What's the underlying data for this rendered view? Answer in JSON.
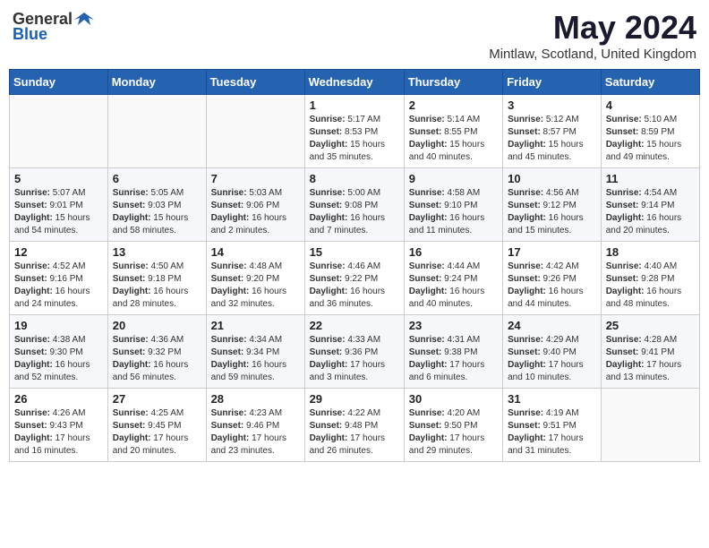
{
  "header": {
    "logo_general": "General",
    "logo_blue": "Blue",
    "title": "May 2024",
    "location": "Mintlaw, Scotland, United Kingdom"
  },
  "weekdays": [
    "Sunday",
    "Monday",
    "Tuesday",
    "Wednesday",
    "Thursday",
    "Friday",
    "Saturday"
  ],
  "weeks": [
    [
      {
        "day": "",
        "info": ""
      },
      {
        "day": "",
        "info": ""
      },
      {
        "day": "",
        "info": ""
      },
      {
        "day": "1",
        "info": "Sunrise: 5:17 AM\nSunset: 8:53 PM\nDaylight: 15 hours and 35 minutes."
      },
      {
        "day": "2",
        "info": "Sunrise: 5:14 AM\nSunset: 8:55 PM\nDaylight: 15 hours and 40 minutes."
      },
      {
        "day": "3",
        "info": "Sunrise: 5:12 AM\nSunset: 8:57 PM\nDaylight: 15 hours and 45 minutes."
      },
      {
        "day": "4",
        "info": "Sunrise: 5:10 AM\nSunset: 8:59 PM\nDaylight: 15 hours and 49 minutes."
      }
    ],
    [
      {
        "day": "5",
        "info": "Sunrise: 5:07 AM\nSunset: 9:01 PM\nDaylight: 15 hours and 54 minutes."
      },
      {
        "day": "6",
        "info": "Sunrise: 5:05 AM\nSunset: 9:03 PM\nDaylight: 15 hours and 58 minutes."
      },
      {
        "day": "7",
        "info": "Sunrise: 5:03 AM\nSunset: 9:06 PM\nDaylight: 16 hours and 2 minutes."
      },
      {
        "day": "8",
        "info": "Sunrise: 5:00 AM\nSunset: 9:08 PM\nDaylight: 16 hours and 7 minutes."
      },
      {
        "day": "9",
        "info": "Sunrise: 4:58 AM\nSunset: 9:10 PM\nDaylight: 16 hours and 11 minutes."
      },
      {
        "day": "10",
        "info": "Sunrise: 4:56 AM\nSunset: 9:12 PM\nDaylight: 16 hours and 15 minutes."
      },
      {
        "day": "11",
        "info": "Sunrise: 4:54 AM\nSunset: 9:14 PM\nDaylight: 16 hours and 20 minutes."
      }
    ],
    [
      {
        "day": "12",
        "info": "Sunrise: 4:52 AM\nSunset: 9:16 PM\nDaylight: 16 hours and 24 minutes."
      },
      {
        "day": "13",
        "info": "Sunrise: 4:50 AM\nSunset: 9:18 PM\nDaylight: 16 hours and 28 minutes."
      },
      {
        "day": "14",
        "info": "Sunrise: 4:48 AM\nSunset: 9:20 PM\nDaylight: 16 hours and 32 minutes."
      },
      {
        "day": "15",
        "info": "Sunrise: 4:46 AM\nSunset: 9:22 PM\nDaylight: 16 hours and 36 minutes."
      },
      {
        "day": "16",
        "info": "Sunrise: 4:44 AM\nSunset: 9:24 PM\nDaylight: 16 hours and 40 minutes."
      },
      {
        "day": "17",
        "info": "Sunrise: 4:42 AM\nSunset: 9:26 PM\nDaylight: 16 hours and 44 minutes."
      },
      {
        "day": "18",
        "info": "Sunrise: 4:40 AM\nSunset: 9:28 PM\nDaylight: 16 hours and 48 minutes."
      }
    ],
    [
      {
        "day": "19",
        "info": "Sunrise: 4:38 AM\nSunset: 9:30 PM\nDaylight: 16 hours and 52 minutes."
      },
      {
        "day": "20",
        "info": "Sunrise: 4:36 AM\nSunset: 9:32 PM\nDaylight: 16 hours and 56 minutes."
      },
      {
        "day": "21",
        "info": "Sunrise: 4:34 AM\nSunset: 9:34 PM\nDaylight: 16 hours and 59 minutes."
      },
      {
        "day": "22",
        "info": "Sunrise: 4:33 AM\nSunset: 9:36 PM\nDaylight: 17 hours and 3 minutes."
      },
      {
        "day": "23",
        "info": "Sunrise: 4:31 AM\nSunset: 9:38 PM\nDaylight: 17 hours and 6 minutes."
      },
      {
        "day": "24",
        "info": "Sunrise: 4:29 AM\nSunset: 9:40 PM\nDaylight: 17 hours and 10 minutes."
      },
      {
        "day": "25",
        "info": "Sunrise: 4:28 AM\nSunset: 9:41 PM\nDaylight: 17 hours and 13 minutes."
      }
    ],
    [
      {
        "day": "26",
        "info": "Sunrise: 4:26 AM\nSunset: 9:43 PM\nDaylight: 17 hours and 16 minutes."
      },
      {
        "day": "27",
        "info": "Sunrise: 4:25 AM\nSunset: 9:45 PM\nDaylight: 17 hours and 20 minutes."
      },
      {
        "day": "28",
        "info": "Sunrise: 4:23 AM\nSunset: 9:46 PM\nDaylight: 17 hours and 23 minutes."
      },
      {
        "day": "29",
        "info": "Sunrise: 4:22 AM\nSunset: 9:48 PM\nDaylight: 17 hours and 26 minutes."
      },
      {
        "day": "30",
        "info": "Sunrise: 4:20 AM\nSunset: 9:50 PM\nDaylight: 17 hours and 29 minutes."
      },
      {
        "day": "31",
        "info": "Sunrise: 4:19 AM\nSunset: 9:51 PM\nDaylight: 17 hours and 31 minutes."
      },
      {
        "day": "",
        "info": ""
      }
    ]
  ]
}
